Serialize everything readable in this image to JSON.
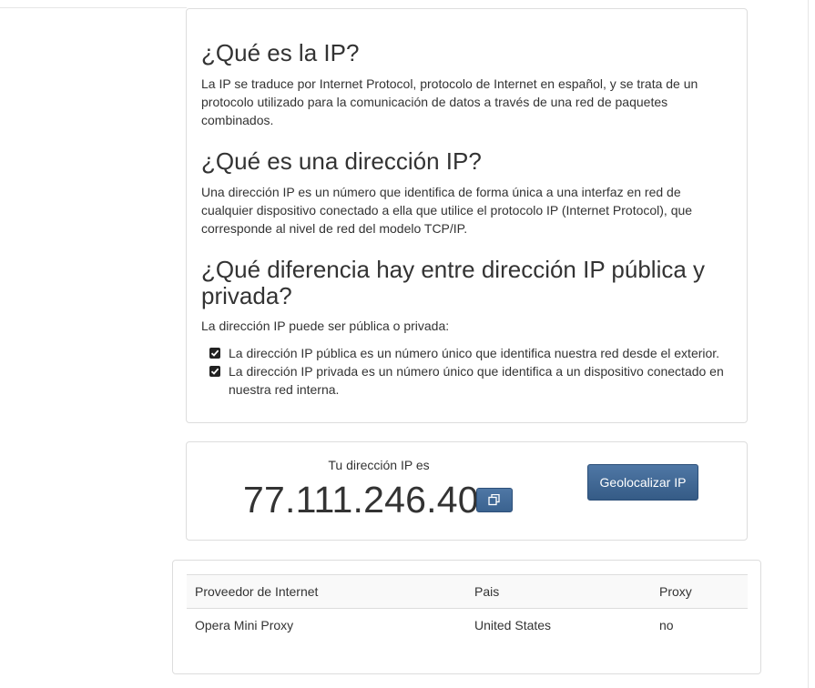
{
  "info": {
    "heading_1": "¿Qué es la IP?",
    "paragraph_1": "La IP se traduce por Internet Protocol, protocolo de Internet en español, y se trata de un protocolo utilizado para la comunicación de datos a través de una red de paquetes combinados.",
    "heading_2": "¿Qué es una dirección IP?",
    "paragraph_2": "Una dirección IP es un número que identifica de forma única a una interfaz en red de cualquier dispositivo conectado a ella que utilice el protocolo IP (Internet Protocol), que corresponde al nivel de red del modelo TCP/IP.",
    "heading_3": "¿Qué diferencia hay entre dirección IP pública y privada?",
    "paragraph_3": "La dirección IP puede ser pública o privada:",
    "list": [
      "La dirección IP pública es un número único que identifica nuestra red desde el exterior.",
      "La dirección IP privada es un número único que identifica a un dispositivo conectado en nuestra red interna."
    ]
  },
  "ip_box": {
    "label": "Tu dirección IP es",
    "address": "77.111.246.40",
    "copy_icon": "copy-icon",
    "geo_button": "Geolocalizar IP"
  },
  "table": {
    "headers": [
      "Proveedor de Internet",
      "Pais",
      "Proxy"
    ],
    "rows": [
      [
        "Opera Mini Proxy",
        "United States",
        "no"
      ]
    ]
  },
  "colors": {
    "button": "#3f6896",
    "text": "#333333",
    "border": "#dddddd"
  }
}
